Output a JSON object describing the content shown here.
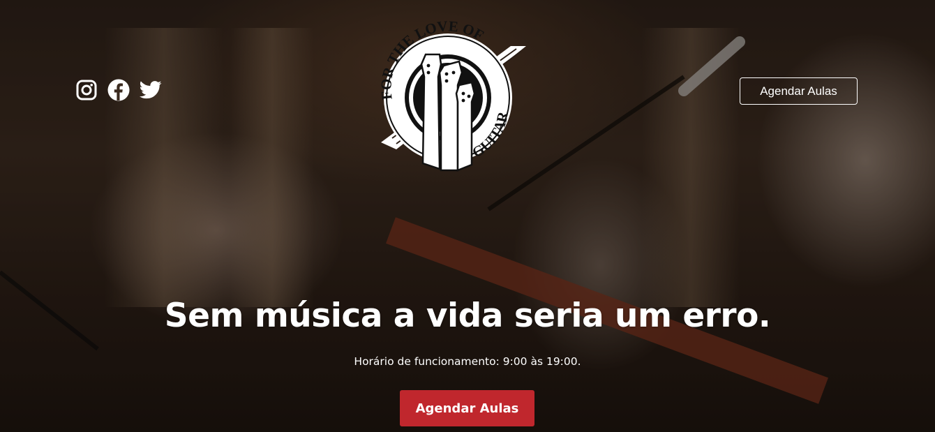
{
  "header": {
    "social_icons": [
      "instagram-icon",
      "facebook-icon",
      "twitter-icon"
    ],
    "logo_text": {
      "top": "FOR THE LOVE OF",
      "bottom": "GUITAR"
    },
    "schedule_button_label": "Agendar Aulas"
  },
  "hero": {
    "headline": "Sem música a vida seria um erro.",
    "hours": "Horário de funcionamento: 9:00 às 19:00.",
    "cta_label": "Agendar Aulas"
  },
  "colors": {
    "accent": "#c0272d",
    "text": "#ffffff"
  }
}
